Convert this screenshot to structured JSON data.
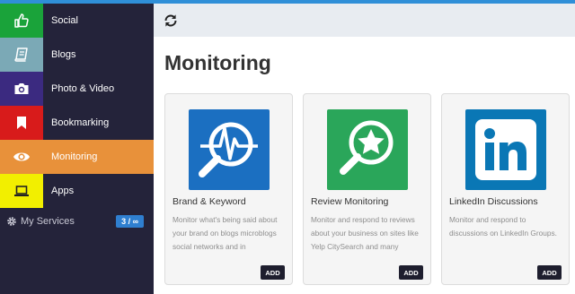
{
  "sidebar": {
    "items": [
      {
        "label": "Social",
        "icon": "thumbs-up-icon",
        "color": "#1aa33a"
      },
      {
        "label": "Blogs",
        "icon": "book-icon",
        "color": "#7ba9b6"
      },
      {
        "label": "Photo & Video",
        "icon": "camera-icon",
        "color": "#3b2a80"
      },
      {
        "label": "Bookmarking",
        "icon": "bookmark-icon",
        "color": "#d81b1b"
      },
      {
        "label": "Monitoring",
        "icon": "eye-icon",
        "color": "#e8913a",
        "active": true
      },
      {
        "label": "Apps",
        "icon": "laptop-icon",
        "color": "#f2ef00"
      }
    ],
    "services": {
      "label": "My Services",
      "badge": "3 / ∞",
      "icon": "gear-icon"
    }
  },
  "toolbar": {
    "icon": "refresh-icon"
  },
  "page": {
    "title": "Monitoring"
  },
  "cards": [
    {
      "title": "Brand & Keyword",
      "description": "Monitor what's being said about your brand on blogs microblogs social networks and in",
      "button": "ADD",
      "logo_color": "#1b6fc1",
      "icon": "keyword-search-icon"
    },
    {
      "title": "Review Monitoring",
      "description": "Monitor and respond to reviews about your business on sites like Yelp CitySearch and many",
      "button": "ADD",
      "logo_color": "#2aa65a",
      "icon": "star-search-icon"
    },
    {
      "title": "LinkedIn Discussions",
      "description": "Monitor and respond to discussions on LinkedIn Groups.",
      "button": "ADD",
      "logo_color": "#0a77b5",
      "icon": "linkedin-icon"
    }
  ]
}
